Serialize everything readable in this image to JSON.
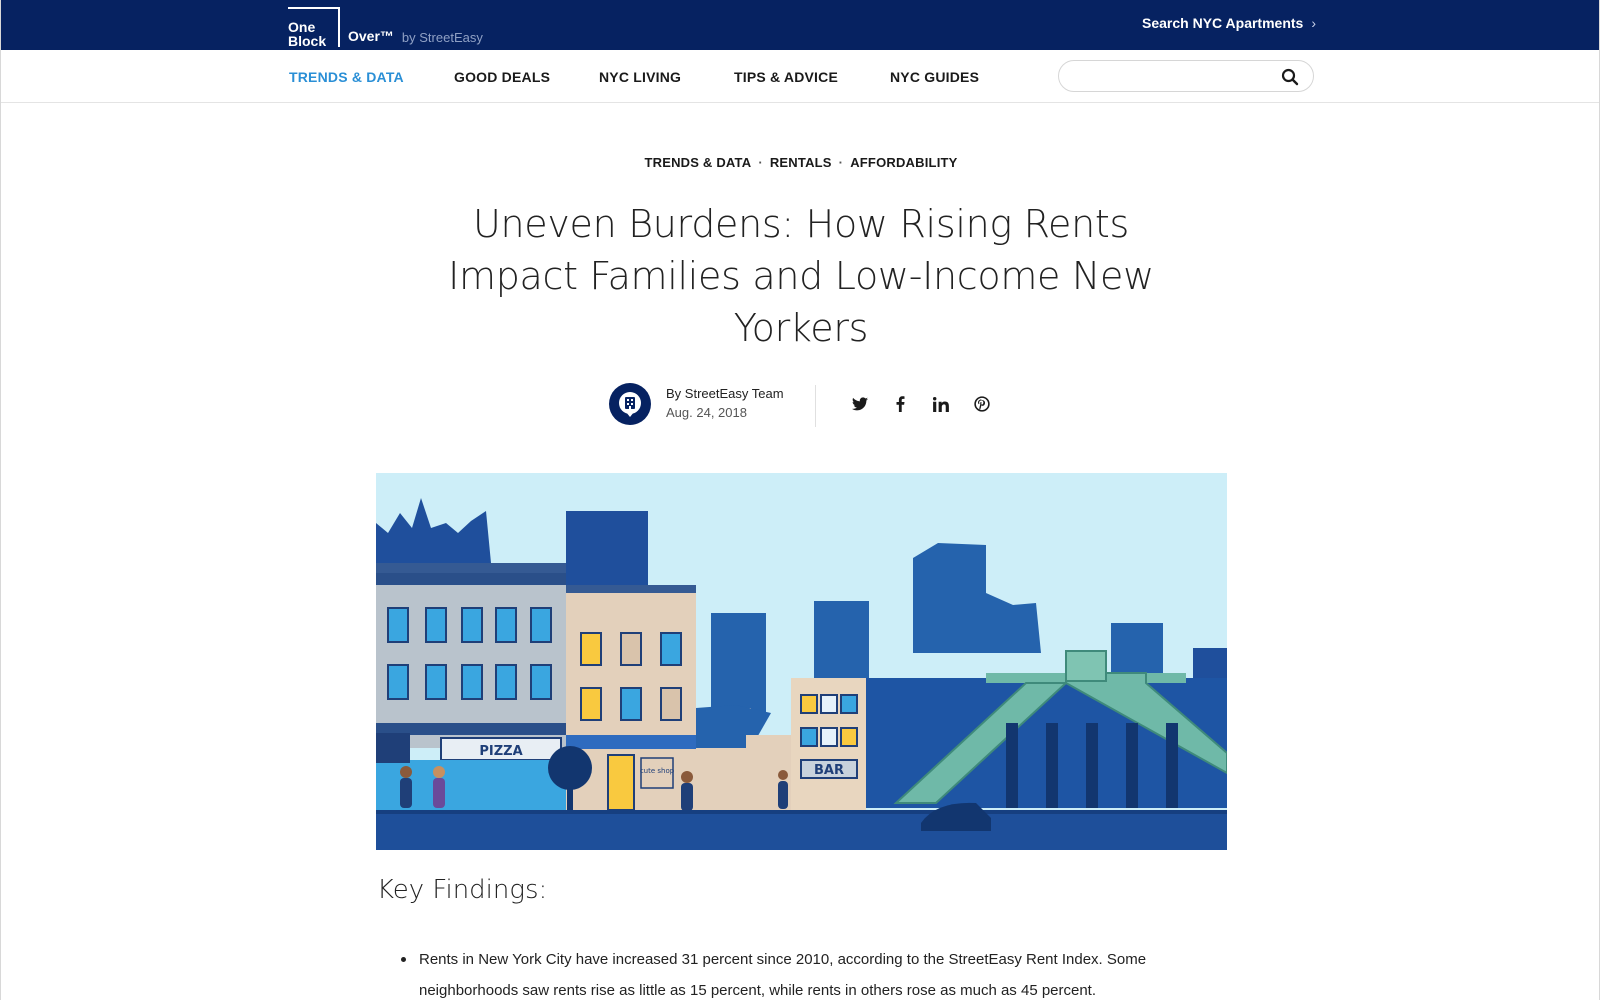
{
  "brand": {
    "logo_line1": "One",
    "logo_line2": "Block",
    "logo_line3": "Over™",
    "logo_by": "by StreetEasy",
    "color_primary": "#062261",
    "color_accent": "#2a8fd6"
  },
  "topbar": {
    "search_link": "Search NYC Apartments",
    "search_link_icon": "chevron-right-icon"
  },
  "nav": {
    "items": [
      {
        "label": "TRENDS & DATA",
        "active": true
      },
      {
        "label": "GOOD DEALS",
        "active": false
      },
      {
        "label": "NYC LIVING",
        "active": false
      },
      {
        "label": "TIPS & ADVICE",
        "active": false
      },
      {
        "label": "NYC GUIDES",
        "active": false
      }
    ],
    "search": {
      "value": "",
      "placeholder": "",
      "icon": "search-icon"
    }
  },
  "article": {
    "categories": [
      "TRENDS & DATA",
      "RENTALS",
      "AFFORDABILITY"
    ],
    "title": "Uneven Burdens: How Rising Rents Impact Families and Low-Income New Yorkers",
    "author": "By StreetEasy Team",
    "date": "Aug. 24, 2018",
    "share_icons": [
      "twitter-icon",
      "facebook-icon",
      "linkedin-icon",
      "pinterest-icon"
    ],
    "hero_signs": {
      "pizza": "PIZZA",
      "bar": "BAR",
      "shop": "cute shop"
    },
    "section_heading": "Key Findings:",
    "findings": [
      "Rents in New York City have increased 31 percent since 2010, according to the StreetEasy Rent Index. Some neighborhoods saw rents rise as little as 15 percent, while rents in others rose as much as 45 percent."
    ]
  }
}
